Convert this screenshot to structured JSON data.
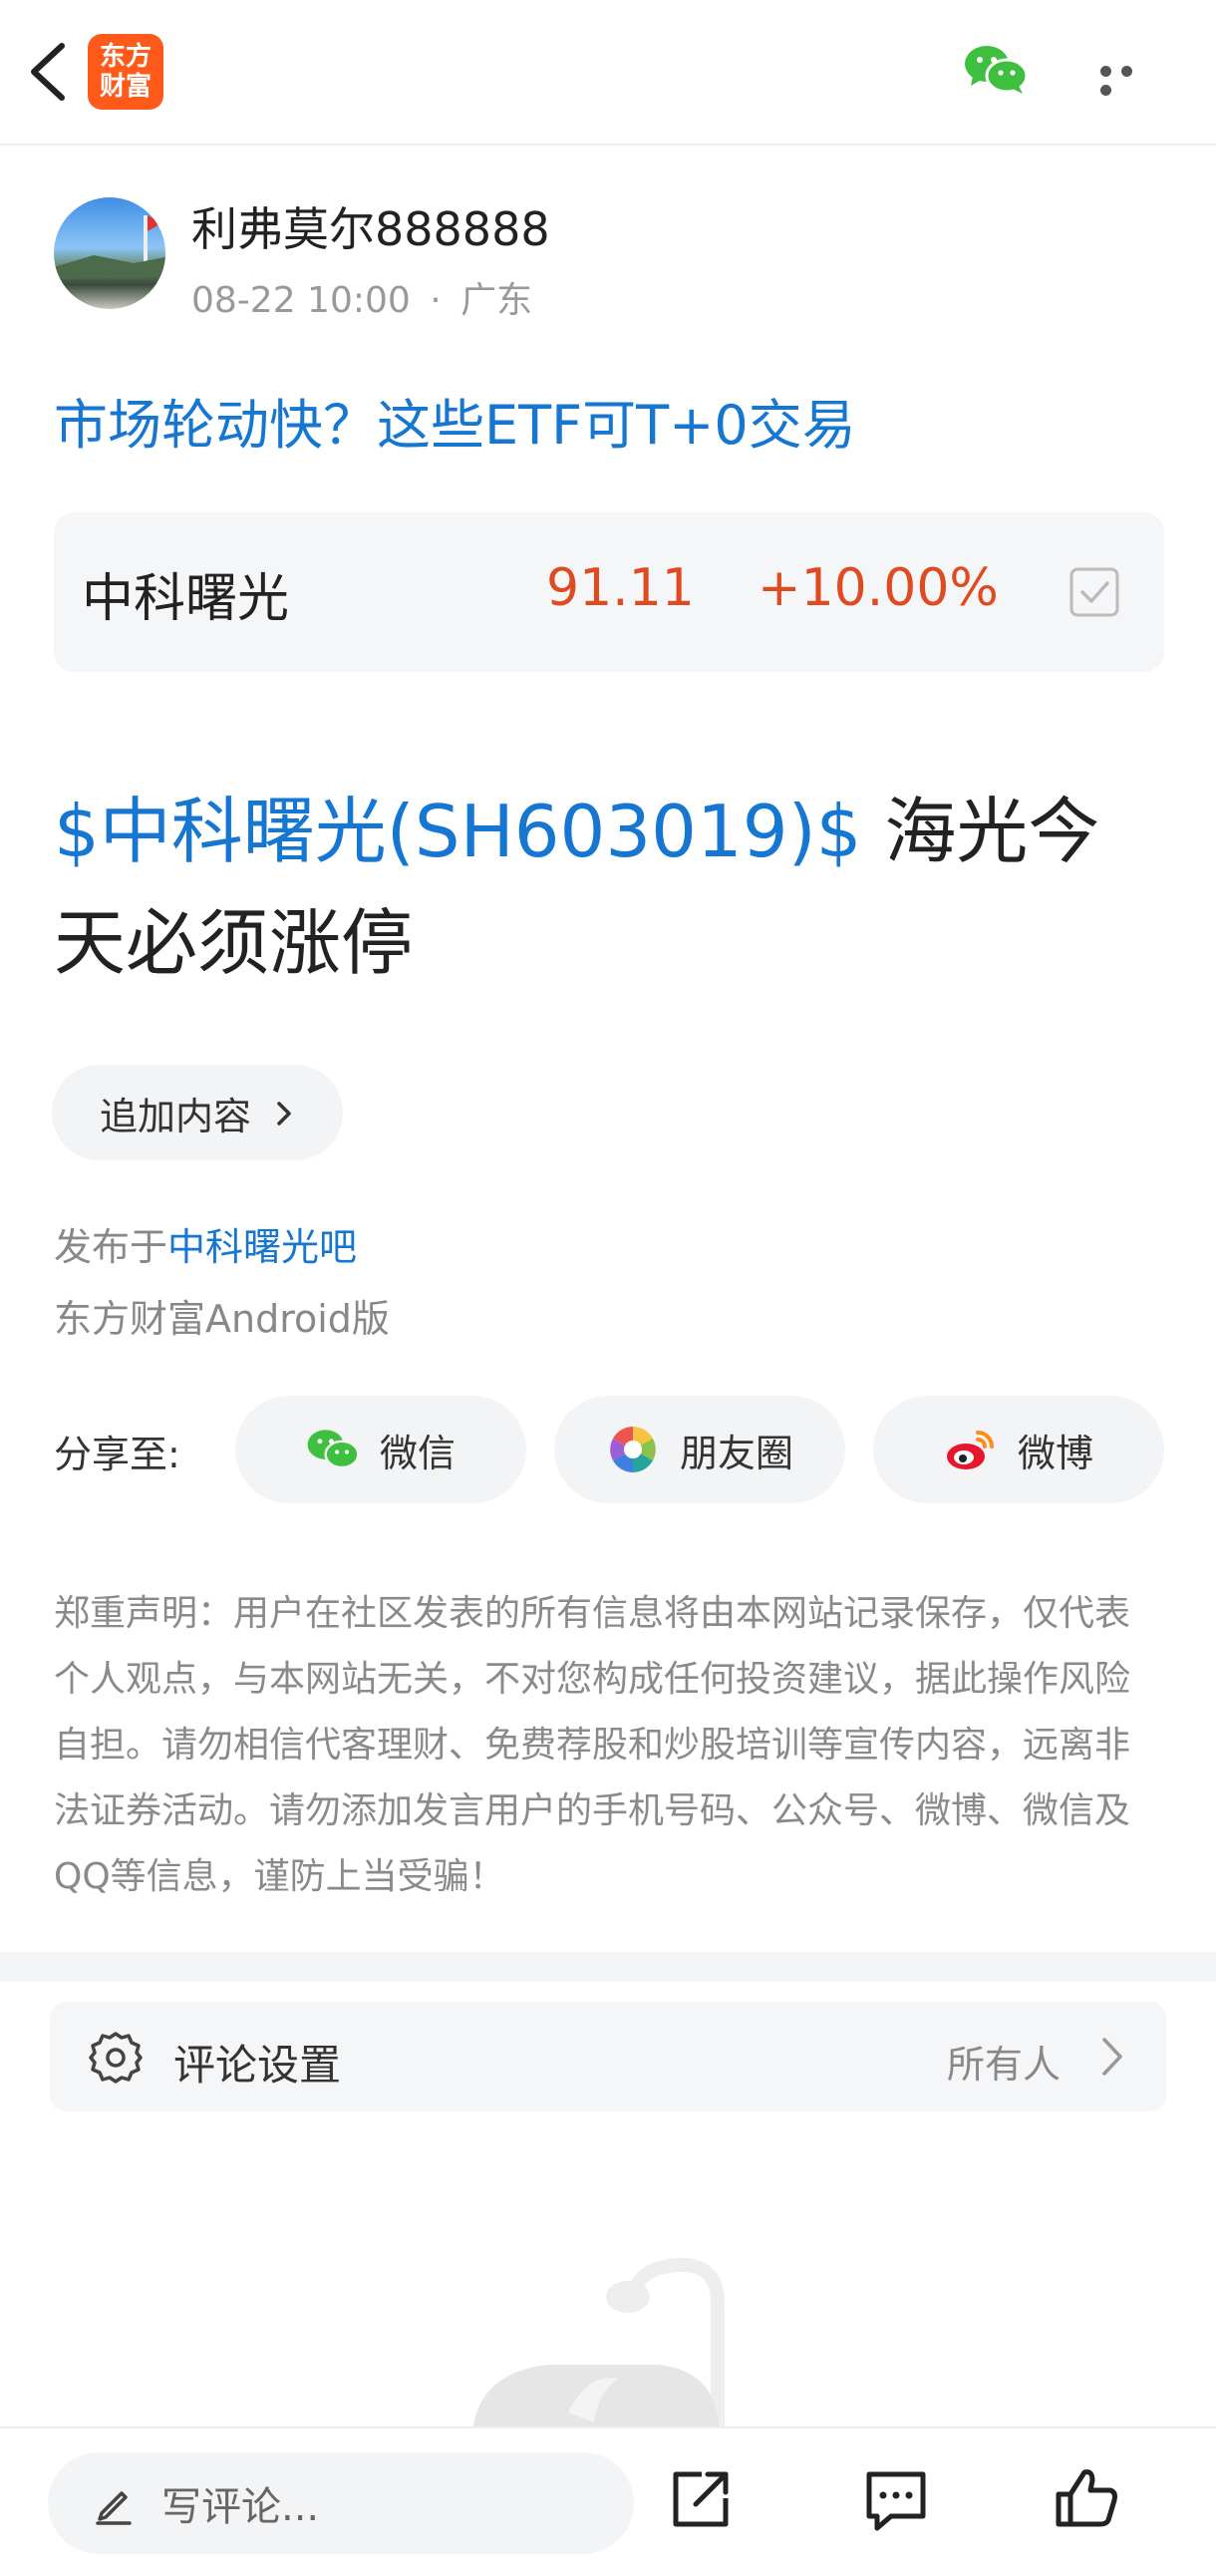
{
  "header": {
    "logo_line1": "东方",
    "logo_line2": "财富",
    "back_icon": "back-arrow-icon",
    "share_icon": "wechat-icon",
    "more_icon": "more-dots-icon"
  },
  "author": {
    "name": "利弗莫尔888888",
    "date": "08-22 10:00",
    "separator": "·",
    "location": "广东"
  },
  "post": {
    "title": "市场轮动快？这些ETF可T+0交易",
    "stock_mention": "$中科曙光(SH603019)$",
    "body_text": " 海光今天必须涨停"
  },
  "stock_card": {
    "name": "中科曙光",
    "price": "91.11",
    "change": "+10.00%",
    "color": "#e04a20"
  },
  "append_button": {
    "label": "追加内容"
  },
  "publish": {
    "prefix": "发布于",
    "bar_name": "中科曙光吧",
    "client": "东方财富Android版"
  },
  "share": {
    "label": "分享至:",
    "items": [
      {
        "label": "微信",
        "icon": "wechat-icon"
      },
      {
        "label": "朋友圈",
        "icon": "moments-icon"
      },
      {
        "label": "微博",
        "icon": "weibo-icon"
      }
    ]
  },
  "disclaimer": "郑重声明：用户在社区发表的所有信息将由本网站记录保存，仅代表个人观点，与本网站无关，不对您构成任何投资建议，据此操作风险自担。请勿相信代客理财、免费荐股和炒股培训等宣传内容，远离非法证券活动。请勿添加发言用户的手机号码、公众号、微博、微信及QQ等信息，谨防上当受骗！",
  "comment_settings": {
    "label": "评论设置",
    "value": "所有人"
  },
  "bottom_bar": {
    "input_placeholder": "写评论...",
    "icons": [
      "share-out-icon",
      "comment-icon",
      "like-icon"
    ]
  },
  "colors": {
    "brand": "#ff5a1a",
    "link": "#1677d2",
    "up": "#e04a20"
  }
}
